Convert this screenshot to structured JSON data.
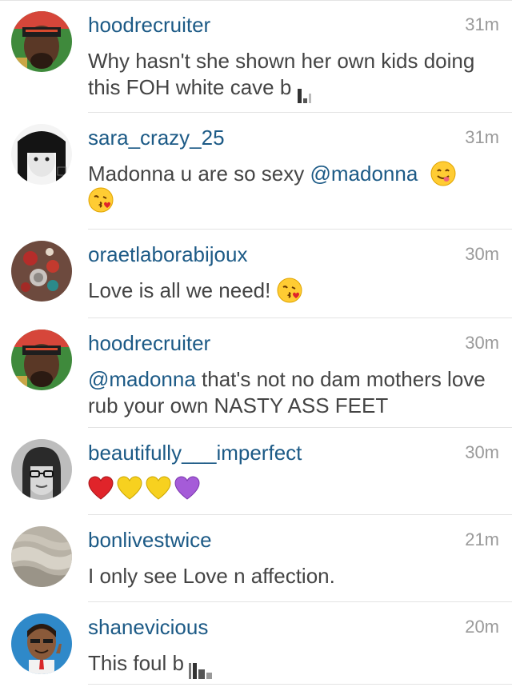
{
  "comments": [
    {
      "username": "hoodrecruiter",
      "time": "31m",
      "text": "Why hasn't she shown her own kids doing this FOH white cave b"
    },
    {
      "username": "sara_crazy_25",
      "time": "31m",
      "text_before": "Madonna u are so sexy ",
      "mention": "@madonna",
      "emojis": [
        "yum-face-emoji",
        "kiss-face-emoji"
      ]
    },
    {
      "username": "oraetlaborabijoux",
      "time": "30m",
      "text": "Love is all we need! ",
      "emojis": [
        "kiss-face-emoji"
      ]
    },
    {
      "username": "hoodrecruiter",
      "time": "30m",
      "mention": "@madonna",
      "text": " that's not no dam mothers love rub your own NASTY ASS FEET"
    },
    {
      "username": "beautifully___imperfect",
      "time": "30m",
      "emojis": [
        "red-heart-emoji",
        "yellow-heart-emoji",
        "yellow-heart-emoji",
        "purple-heart-emoji"
      ],
      "colors": {
        "red": "#e0242a",
        "yellow": "#f7d11f",
        "purple": "#a55bd8"
      }
    },
    {
      "username": "bonlivestwice",
      "time": "21m",
      "text": "I only see Love n affection."
    },
    {
      "username": "shanevicious",
      "time": "20m",
      "text": "This foul b"
    }
  ],
  "colors": {
    "username": "#1c5a86",
    "timestamp": "#9a9a9a",
    "text": "#444444",
    "divider": "#e3e3e3"
  }
}
